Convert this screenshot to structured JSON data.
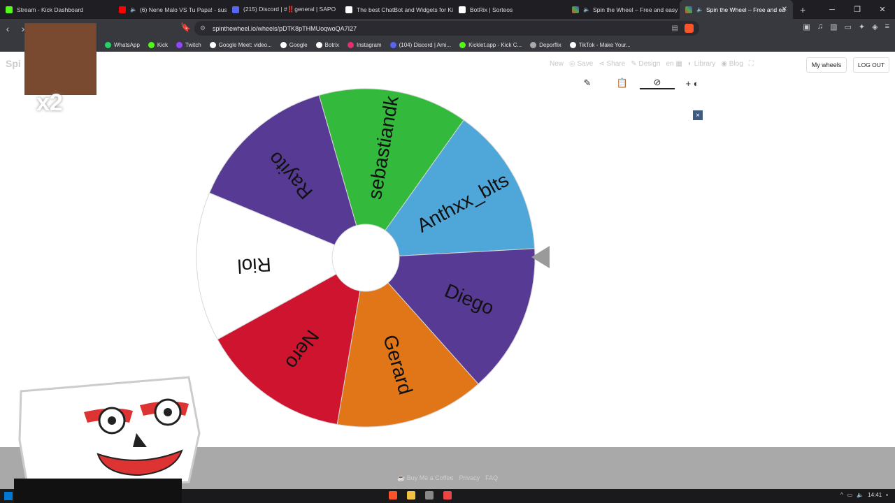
{
  "browser": {
    "tabs": [
      {
        "label": "Stream - Kick Dashboard",
        "color": "#53fc18"
      },
      {
        "label": "(6) Nene Malo VS Tu Papa! - sus",
        "color": "#ff0000"
      },
      {
        "label": "(215) Discord | #‼️general | SAPO",
        "color": "#5865f2"
      },
      {
        "label": "The best ChatBot and Widgets for Ki",
        "color": "#ffffff"
      },
      {
        "label": "BotRix | Sorteos",
        "color": "#ffffff"
      },
      {
        "label": "Spin the Wheel – Free and easy",
        "color": "#e44"
      },
      {
        "label": "Spin the Wheel – Free and ea",
        "color": "#e44"
      }
    ],
    "new_tab": "+",
    "url": "spinthewheel.io/wheels/pDTK8pTHMUoqwoQA7I27",
    "bookmarks": [
      {
        "label": "WhatsApp",
        "color": "#25d366"
      },
      {
        "label": "Kick",
        "color": "#53fc18"
      },
      {
        "label": "Twitch",
        "color": "#9146ff"
      },
      {
        "label": "Google Meet: video...",
        "color": "#00897b"
      },
      {
        "label": "Google",
        "color": "#4285f4"
      },
      {
        "label": "Botrix",
        "color": "#ffffff"
      },
      {
        "label": "Instagram",
        "color": "#e1306c"
      },
      {
        "label": "(104) Discord | Ami...",
        "color": "#5865f2"
      },
      {
        "label": "Kicklet.app - Kick C...",
        "color": "#53fc18"
      },
      {
        "label": "Deporflix",
        "color": "#aaaaaa"
      },
      {
        "label": "TikTok - Make Your...",
        "color": "#ffffff"
      }
    ]
  },
  "site": {
    "logo": "Spi",
    "menu": [
      "New",
      "Save",
      "Share",
      "Design",
      "en",
      "Library",
      "Blog"
    ],
    "my_wheels": "My wheels",
    "logout": "LOG OUT",
    "close": "×"
  },
  "wheel": {
    "segments": [
      {
        "name": "sebastiandk",
        "color": "#33b93c"
      },
      {
        "name": "Anthxx_blts",
        "color": "#4fa6d8"
      },
      {
        "name": "Diego",
        "color": "#573a94"
      },
      {
        "name": "Gerard",
        "color": "#e07618"
      },
      {
        "name": "Nero",
        "color": "#cf1430"
      },
      {
        "name": "Riol",
        "color": "#ffffff"
      },
      {
        "name": "Rayito",
        "color": "#573a94"
      }
    ]
  },
  "footer": {
    "links": [
      "Buy Me a Coffee",
      "Privacy",
      "FAQ"
    ]
  },
  "overlay": {
    "multiplier": "x2"
  },
  "taskbar": {
    "time": "14:41"
  }
}
